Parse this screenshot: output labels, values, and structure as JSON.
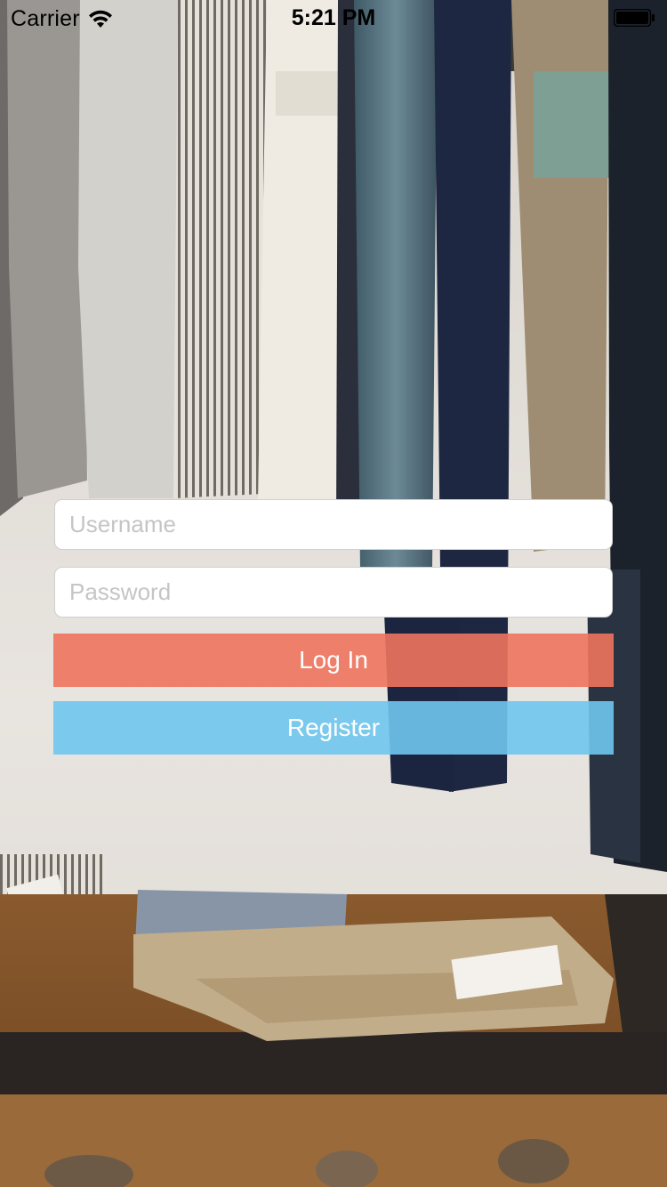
{
  "status_bar": {
    "carrier": "Carrier",
    "time": "5:21 PM",
    "icons": [
      "wifi-icon",
      "battery-icon"
    ]
  },
  "login_form": {
    "username_placeholder": "Username",
    "username_value": "",
    "password_placeholder": "Password",
    "password_value": "",
    "login_label": "Log In",
    "register_label": "Register"
  },
  "colors": {
    "login_button": "#EE745E",
    "register_button": "#6FC6F0",
    "field_background": "#FFFFFF",
    "placeholder_text": "#C5C5C8"
  },
  "background": {
    "description_icon": "clothing-rack-photo"
  }
}
